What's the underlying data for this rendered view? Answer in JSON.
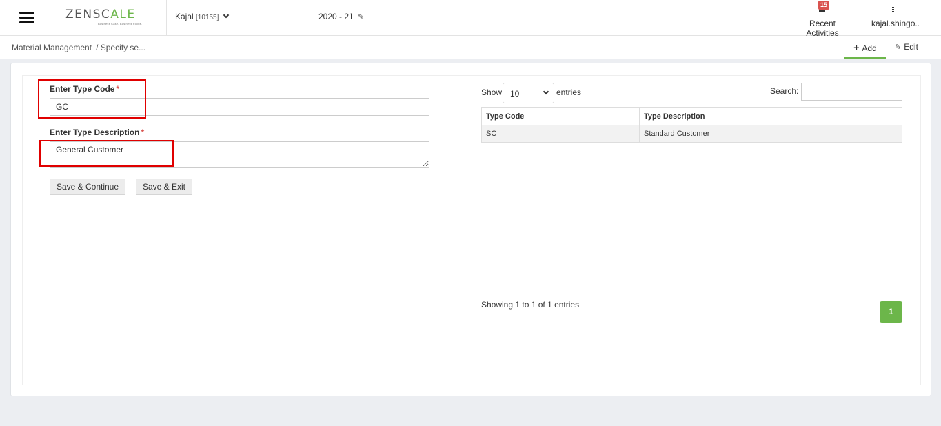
{
  "header": {
    "logo_text_main": "ZENSC",
    "logo_text_accent": "A",
    "logo_text_end": "LE",
    "logo_tagline": "Business Case. Business Focus.",
    "company_name": "Kajal",
    "company_code": "[10155]",
    "fiscal_year": "2020 - 21",
    "recent_label": "Recent Activities",
    "notification_count": "15",
    "user_name": "kajal.shingo.."
  },
  "breadcrumb": {
    "root": "Material Management",
    "current": "/ Specify se..."
  },
  "tabs": {
    "add_label": "Add",
    "edit_label": "Edit"
  },
  "form": {
    "type_code_label": "Enter Type Code",
    "type_code_value": "GC",
    "type_description_label": "Enter Type Description",
    "type_description_value": "General Customer",
    "required_mark": "*",
    "save_continue_label": "Save & Continue",
    "save_exit_label": "Save & Exit"
  },
  "table_controls": {
    "show_label": "Show",
    "page_size": "10",
    "entries_label": "entries",
    "search_label": "Search:"
  },
  "table": {
    "columns": [
      "Type Code",
      "Type Description"
    ],
    "rows": [
      [
        "SC",
        "Standard Customer"
      ]
    ]
  },
  "pagination": {
    "info": "Showing 1 to 1 of 1 entries",
    "current_page": "1"
  },
  "colors": {
    "accent": "#6cb64a",
    "highlight": "#e00000",
    "badge": "#d9534f"
  }
}
